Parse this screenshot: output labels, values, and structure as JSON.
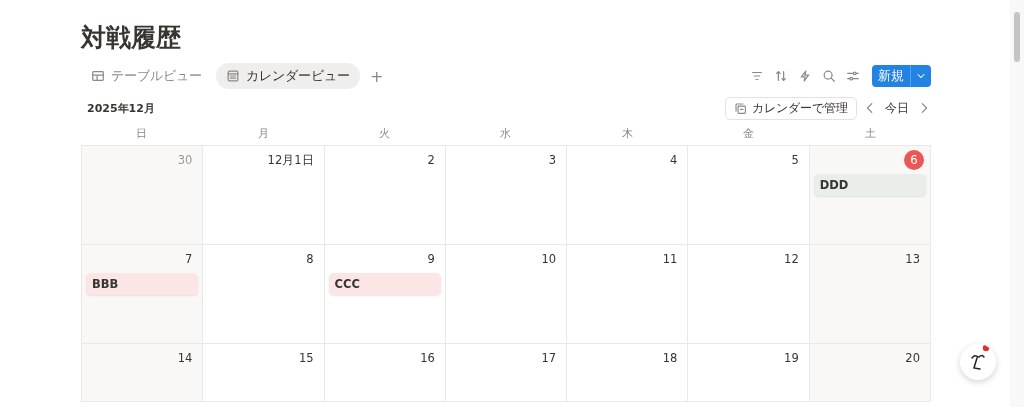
{
  "title": "対戦履歴",
  "tabs": [
    {
      "label": "テーブルビュー",
      "kind": "table",
      "selected": false
    },
    {
      "label": "カレンダービュー",
      "kind": "calendar",
      "selected": true
    }
  ],
  "add_view": "+",
  "new_button": "新規",
  "month": "2025年12月",
  "manage_button": "カレンダーで管理",
  "today_button": "今日",
  "weekdays": [
    "日",
    "月",
    "火",
    "水",
    "木",
    "金",
    "土"
  ],
  "weeks": [
    [
      {
        "date": "30",
        "other_month": true,
        "today": false
      },
      {
        "date": "12月1日",
        "other_month": false,
        "today": false
      },
      {
        "date": "2",
        "other_month": false,
        "today": false
      },
      {
        "date": "3",
        "other_month": false,
        "today": false
      },
      {
        "date": "4",
        "other_month": false,
        "today": false
      },
      {
        "date": "5",
        "other_month": false,
        "today": false
      },
      {
        "date": "6",
        "other_month": false,
        "today": true,
        "events": [
          {
            "title": "DDD",
            "color": "#e9eeea"
          }
        ]
      }
    ],
    [
      {
        "date": "7",
        "other_month": false,
        "today": false,
        "events": [
          {
            "title": "BBB",
            "color": "#fbe5e5"
          }
        ]
      },
      {
        "date": "8",
        "other_month": false,
        "today": false
      },
      {
        "date": "9",
        "other_month": false,
        "today": false,
        "events": [
          {
            "title": "CCC",
            "color": "#fbe5e5"
          }
        ]
      },
      {
        "date": "10",
        "other_month": false,
        "today": false
      },
      {
        "date": "11",
        "other_month": false,
        "today": false
      },
      {
        "date": "12",
        "other_month": false,
        "today": false
      },
      {
        "date": "13",
        "other_month": false,
        "today": false
      }
    ],
    [
      {
        "date": "14",
        "other_month": false,
        "today": false
      },
      {
        "date": "15",
        "other_month": false,
        "today": false
      },
      {
        "date": "16",
        "other_month": false,
        "today": false
      },
      {
        "date": "17",
        "other_month": false,
        "today": false
      },
      {
        "date": "18",
        "other_month": false,
        "today": false
      },
      {
        "date": "19",
        "other_month": false,
        "today": false
      },
      {
        "date": "20",
        "other_month": false,
        "today": false
      }
    ]
  ]
}
